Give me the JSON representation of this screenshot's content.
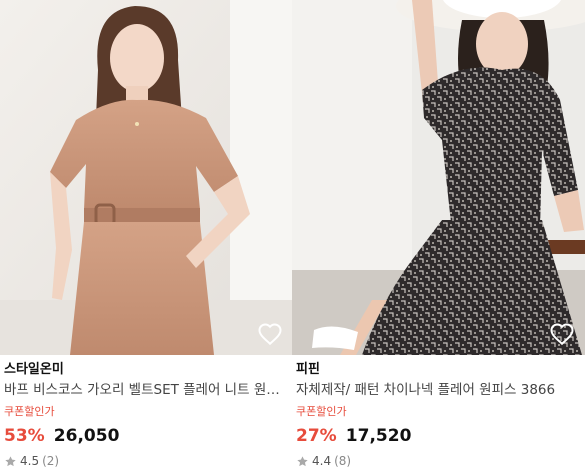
{
  "products": [
    {
      "brand": "스타일온미",
      "title": "바프 비스코스 가오리 벨트SET 플레어 니트 원피스",
      "coupon_label": "쿠폰할인가",
      "discount": "53%",
      "price": "26,050",
      "rating": "4.5",
      "review_count": "(2)",
      "image_icon": "dress-photo",
      "wishlist_icon": "heart-outline-icon",
      "colors": {
        "backdrop": "#eeeae6",
        "dress": "#c9957a",
        "skin": "#f3d8c8",
        "hair": "#5a3a2a"
      }
    },
    {
      "brand": "피핀",
      "title": "자체제작/ 패턴 차이나넥 플레어 원피스 3866",
      "coupon_label": "쿠폰할인가",
      "discount": "27%",
      "price": "17,520",
      "rating": "4.4",
      "review_count": "(8)",
      "image_icon": "dress-photo",
      "wishlist_icon": "heart-outline-icon",
      "colors": {
        "backdrop": "#ecebe8",
        "dress": "#2e2a2b",
        "hat": "#f4f1ec",
        "bench": "#6b3a22"
      }
    }
  ],
  "accent_color": "#e74c3c",
  "star_color": "#a9a9a9"
}
